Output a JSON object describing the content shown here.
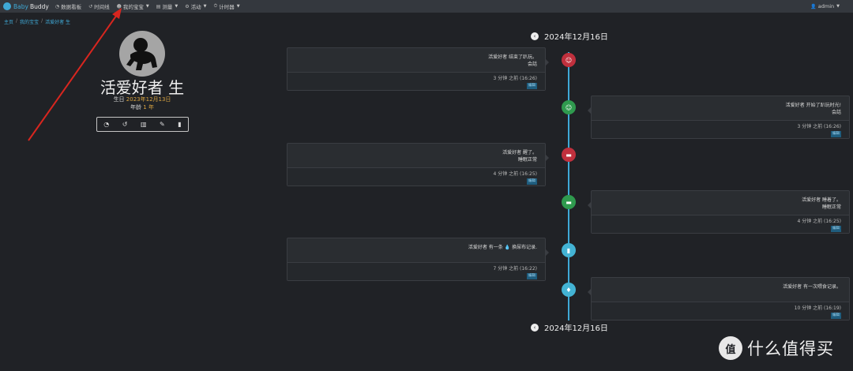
{
  "nav": {
    "brand_baby": "Baby",
    "brand_buddy": "Buddy",
    "items": [
      {
        "label": "数据看板",
        "icon": "dashboard-icon",
        "glyph": "◔"
      },
      {
        "label": "时间线",
        "icon": "history-icon",
        "glyph": "↺"
      },
      {
        "label": "我的宝宝",
        "icon": "child-icon",
        "glyph": "☻"
      },
      {
        "label": "测量",
        "icon": "clipboard-icon",
        "glyph": "▤"
      },
      {
        "label": "活动",
        "icon": "activities-icon",
        "glyph": "⚙"
      },
      {
        "label": "计时器",
        "icon": "timer-icon",
        "glyph": "⏱"
      }
    ],
    "user": "admin"
  },
  "breadcrumb": {
    "home": "主页",
    "children": "我的宝宝",
    "current": "活爱好者 生"
  },
  "child": {
    "name": "活爱好者 生",
    "birth_label": "生日",
    "birth_date": "2023年12月13日",
    "age_label": "年龄",
    "age_value": "1 年"
  },
  "timeline": {
    "date_top": "2024年12月16日",
    "date_bottom": "2024年12月16日",
    "entries": [
      {
        "side": "left",
        "color": "#c0303d",
        "glyph": "☺",
        "icon": "tummy-time-icon",
        "text": "活爱好者 结束了趴玩。",
        "sub": "会話",
        "time": "3 分钟 之前 (16:26)",
        "edit": "编辑"
      },
      {
        "side": "right",
        "color": "#2f9a4e",
        "glyph": "☺",
        "icon": "tummy-time-icon",
        "text": "活爱好者 开始了趴玩时光!",
        "sub": "会話",
        "time": "3 分钟 之前 (16:26)",
        "edit": "编辑"
      },
      {
        "side": "left",
        "color": "#c0303d",
        "glyph": "▬",
        "icon": "bed-icon",
        "text": "活爱好者 醒了。",
        "sub": "睡眠正常",
        "time": "4 分钟 之前 (16:25)",
        "edit": "编辑"
      },
      {
        "side": "right",
        "color": "#2f9a4e",
        "glyph": "▬",
        "icon": "bed-icon",
        "text": "活爱好者 睡着了。",
        "sub": "睡眠正常",
        "time": "4 分钟 之前 (16:25)",
        "edit": "编辑"
      },
      {
        "side": "left",
        "color": "#43b3d4",
        "glyph": "▮",
        "icon": "diaper-icon",
        "text": "活爱好者 有一条",
        "text_drop": "💧",
        "text_tail": "换尿布记录.",
        "sub": "",
        "time": "7 分钟 之前 (16:22)",
        "edit": "编辑"
      },
      {
        "side": "right",
        "color": "#43b3d4",
        "glyph": "♦",
        "icon": "feeding-icon",
        "text": "活爱好者 有一次喂食记录。",
        "sub": "",
        "time": "10 分钟 之前 (16:19)",
        "edit": "编辑"
      }
    ]
  },
  "watermark": {
    "logo": "值",
    "text": "什么值得买"
  }
}
